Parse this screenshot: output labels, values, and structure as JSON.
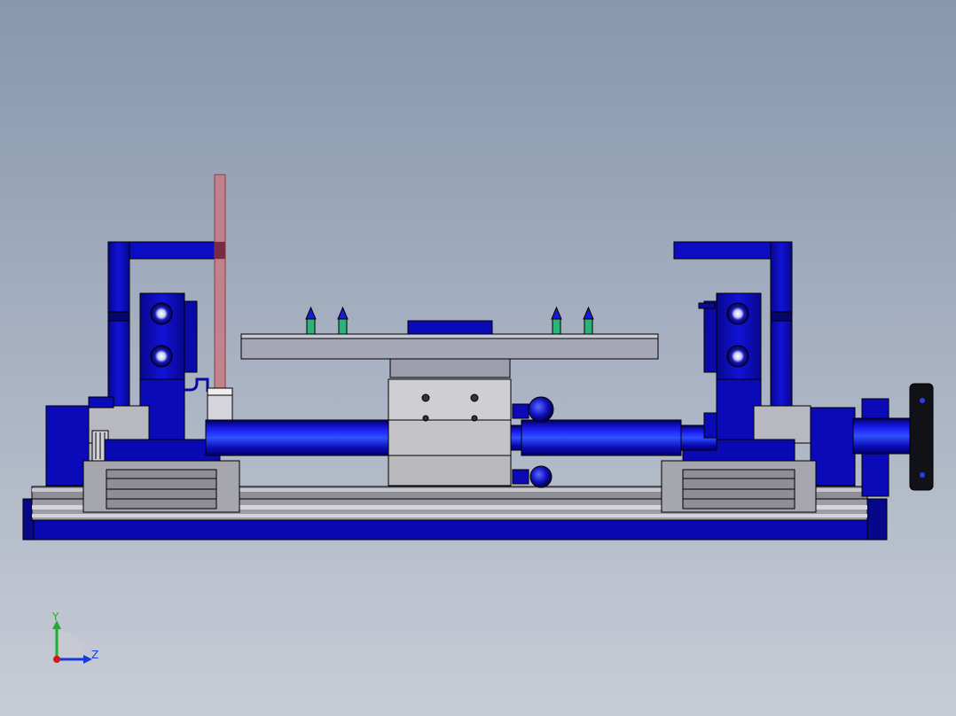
{
  "viewport": {
    "background_top": "#8797ae",
    "background_bottom": "#c8ccd6"
  },
  "colors": {
    "part_blue": "#0b0bc8",
    "part_blue_dark": "#05057a",
    "part_blue_light": "#2a3cf0",
    "part_grey": "#9a9aa2",
    "part_grey_light": "#c4c4c8",
    "part_grey_dark": "#6e6e74",
    "table_top": "#a6a8b8",
    "laser_beam": "#c77a84",
    "marker_green": "#2db37a",
    "edge": "#000000"
  },
  "triad": {
    "y_label": "Y",
    "z_label": "Z",
    "y_color": "#1fae2f",
    "z_color": "#1a3ad8",
    "x_color": "#d01818"
  }
}
